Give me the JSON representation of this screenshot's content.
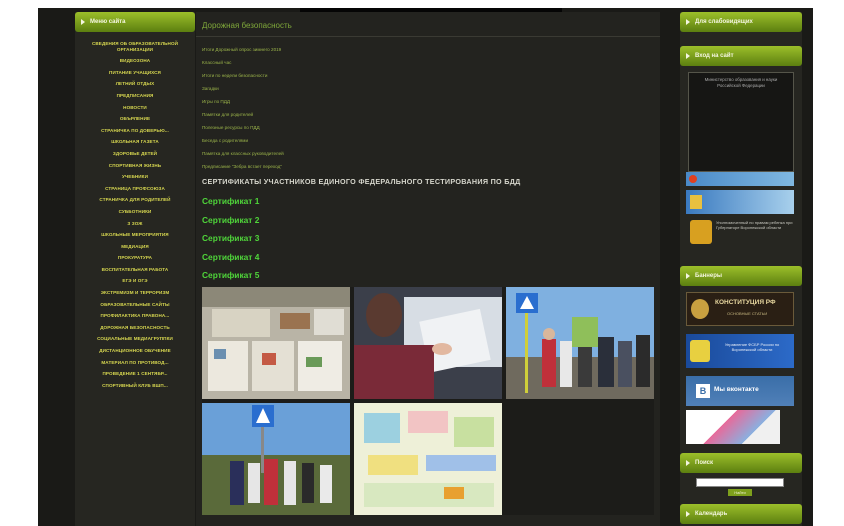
{
  "left_menu": {
    "title": "Меню сайта",
    "items": [
      "Сведения об образовательной организации",
      "Видеозона",
      "Питание учащихся",
      "Летний отдых",
      "Предписания",
      "Новости",
      "Обърление",
      "Страничка по доверью...",
      "Школьная газета",
      "Здоровье детей",
      "Спортивная жизнь",
      "Учебники",
      "Страница профсоюза",
      "Страничка для родителей",
      "Субботники",
      "З ЗОЖ",
      "Школьные мероприятия",
      "Медиация",
      "Прокуратура",
      "Воспитательная работа",
      "ЕГЭ и ОГЭ",
      "Экстремизм и терроризм",
      "Образовательные сайты",
      "Профилактика правона...",
      "Дорожная безопасность",
      "Социальные медиагруппки",
      "Дистанционное обучение",
      "Материал по противод...",
      "Проведение 1 сентябр...",
      "Спортивный клуб Вшп..."
    ]
  },
  "main": {
    "title": "Дорожная безопасность",
    "links": [
      "Итоги Дорожный опрос зимнего 2019",
      "Классный час",
      "Итоги по недели безопасности",
      "Загадки",
      "Игры по ПДД",
      "Памятки для родителей",
      "Полезные ресурсы по ПДД",
      "Беседа с родителями",
      "Памятка для классных руководителей",
      "Предписание \"Зебра встает переход\""
    ],
    "cert_heading": "СЕРТИФИКАТЫ УЧАСТНИКОВ  ЕДИНОГО ФЕДЕРАЛЬНОГО ТЕСТИРОВАНИЯ  ПО БДД",
    "certificates": [
      "Сертификат 1",
      "Сертификат 2",
      "Сертификат 3",
      "Сертификат 4",
      "Сертификат 5"
    ]
  },
  "right": {
    "head1": "Для слабовидящих",
    "head2": "Вход на сайт",
    "login_img_alt": "Министерство образования и науки Российской Федерации",
    "banner_text": "Уполномоченный по правам ребенка при Губернаторе Воронежской области",
    "head3": "Баннеры",
    "konst_text": "КОНСТИТУЦИЯ РФ",
    "konst_sub": "ОСНОВНЫЕ СТАТЬИ",
    "fssp_text": "Управление ФСБР России по Воронежской области",
    "vk_text": "Мы вконтакте",
    "head4": "Поиск",
    "search_btn": "Найти",
    "head5": "Календарь"
  },
  "colors": {
    "accent_green": "#7ea01c",
    "menu_yellow": "#d8d850",
    "cert_green": "#4fd63a",
    "link_green": "#9bb44a"
  }
}
